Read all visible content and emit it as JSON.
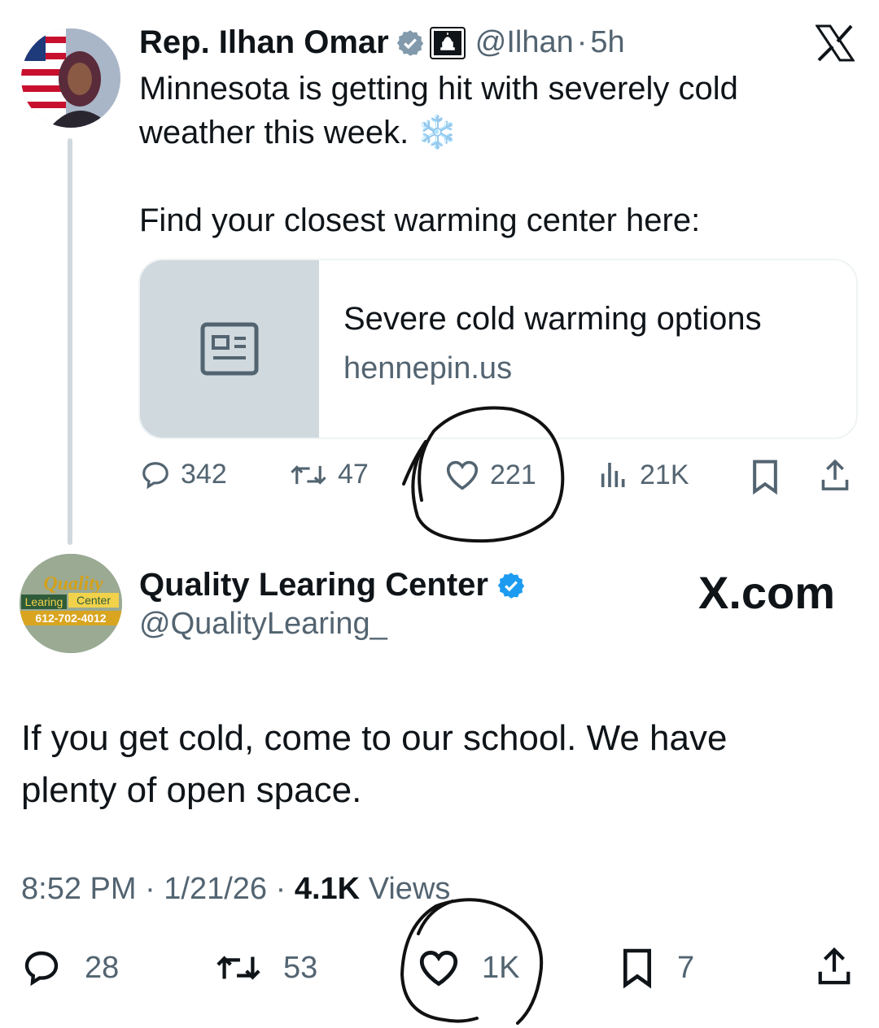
{
  "tweet1": {
    "name": "Rep. Ilhan Omar",
    "handle": "@Ilhan",
    "separator": "·",
    "time": "5h",
    "line1": "Minnesota is getting hit with severely cold",
    "line2": "weather this week.",
    "emoji": "❄️",
    "line3": "Find your closest warming center here:",
    "card": {
      "title": "Severe cold warming options",
      "domain": "hennepin.us"
    },
    "stats": {
      "replies": "342",
      "reposts": "47",
      "likes": "221",
      "views": "21K"
    }
  },
  "tweet2": {
    "name": "Quality Learing Center",
    "handle": "@QualityLearing_",
    "line1": "If you get cold, come to our school. We have",
    "line2": "plenty of open space.",
    "timestamp": "8:52 PM · 1/21/26 ·",
    "views_count": "4.1K",
    "views_label": "Views",
    "stats": {
      "replies": "28",
      "reposts": "53",
      "likes": "1K",
      "bookmarks": "7"
    },
    "avatar_text": {
      "brand": "Quality",
      "label1": "Learing",
      "label2": "Center",
      "phone": "612-702-4012"
    }
  },
  "watermark": "X.com",
  "colors": {
    "verified_blue": "#1d9bf0",
    "muted": "#536471",
    "text": "#0f1419",
    "card_thumb": "#cfd9de"
  }
}
